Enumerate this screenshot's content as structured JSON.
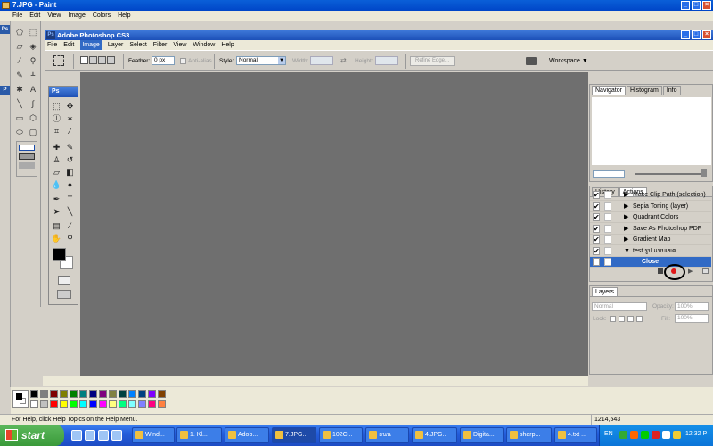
{
  "paint": {
    "title": "7.JPG - Paint",
    "menu": [
      "File",
      "Edit",
      "View",
      "Image",
      "Colors",
      "Help"
    ],
    "status": "For Help, click Help Topics on the Help Menu.",
    "coords": "1214,543"
  },
  "photoshop": {
    "title": "Adobe Photoshop CS3",
    "menu": [
      "File",
      "Edit",
      "Image",
      "Layer",
      "Select",
      "Filter",
      "View",
      "Window",
      "Help"
    ],
    "active_menu_index": 2,
    "options": {
      "feather_label": "Feather:",
      "feather_value": "0 px",
      "antialias_label": "Anti-alias",
      "style_label": "Style:",
      "style_value": "Normal",
      "width_label": "Width:",
      "height_label": "Height:",
      "refine_edge": "Refine Edge...",
      "workspace": "Workspace ▼"
    },
    "toolbox_header": "Ps"
  },
  "panels": {
    "navigator_tabs": [
      "Navigator",
      "Histogram",
      "Info"
    ],
    "history_tabs": [
      "History",
      "Actions"
    ],
    "actions": [
      {
        "label": "Make Clip Path (selection)",
        "checked": true,
        "tri": "▶"
      },
      {
        "label": "Sepia Toning (layer)",
        "checked": true,
        "tri": "▶"
      },
      {
        "label": "Quadrant Colors",
        "checked": true,
        "tri": "▶"
      },
      {
        "label": "Save As Photoshop PDF",
        "checked": true,
        "tri": "▶"
      },
      {
        "label": "Gradient Map",
        "checked": true,
        "tri": "▶"
      },
      {
        "label": "test รูป แบบเขต",
        "checked": true,
        "tri": "▼"
      },
      {
        "label": "Close",
        "checked": true,
        "tri": "",
        "selected": true
      }
    ],
    "layers_tab": "Layers",
    "blend_mode": "Normal",
    "opacity_label": "Opacity:",
    "opacity_value": "100%",
    "lock_label": "Lock:",
    "fill_label": "Fill:",
    "fill_value": "100%"
  },
  "palette_colors": [
    "#000000",
    "#808080",
    "#800000",
    "#808000",
    "#008000",
    "#008080",
    "#000080",
    "#800080",
    "#808040",
    "#004040",
    "#0080ff",
    "#004080",
    "#8000ff",
    "#804000",
    "#ffffff",
    "#c0c0c0",
    "#ff0000",
    "#ffff00",
    "#00ff00",
    "#00ffff",
    "#0000ff",
    "#ff00ff",
    "#ffff80",
    "#00ff80",
    "#80ffff",
    "#8080ff",
    "#ff0080",
    "#ff8040"
  ],
  "taskbar": {
    "start": "start",
    "tasks": [
      "Wind...",
      "1. Kl...",
      "Adob...",
      "7.JPG...",
      "102C...",
      "ธนน",
      "4.JPG...",
      "Digita...",
      "sharp...",
      "4.txt ..."
    ],
    "active_task_index": 3,
    "lang": "EN",
    "clock": "12:32 P"
  }
}
